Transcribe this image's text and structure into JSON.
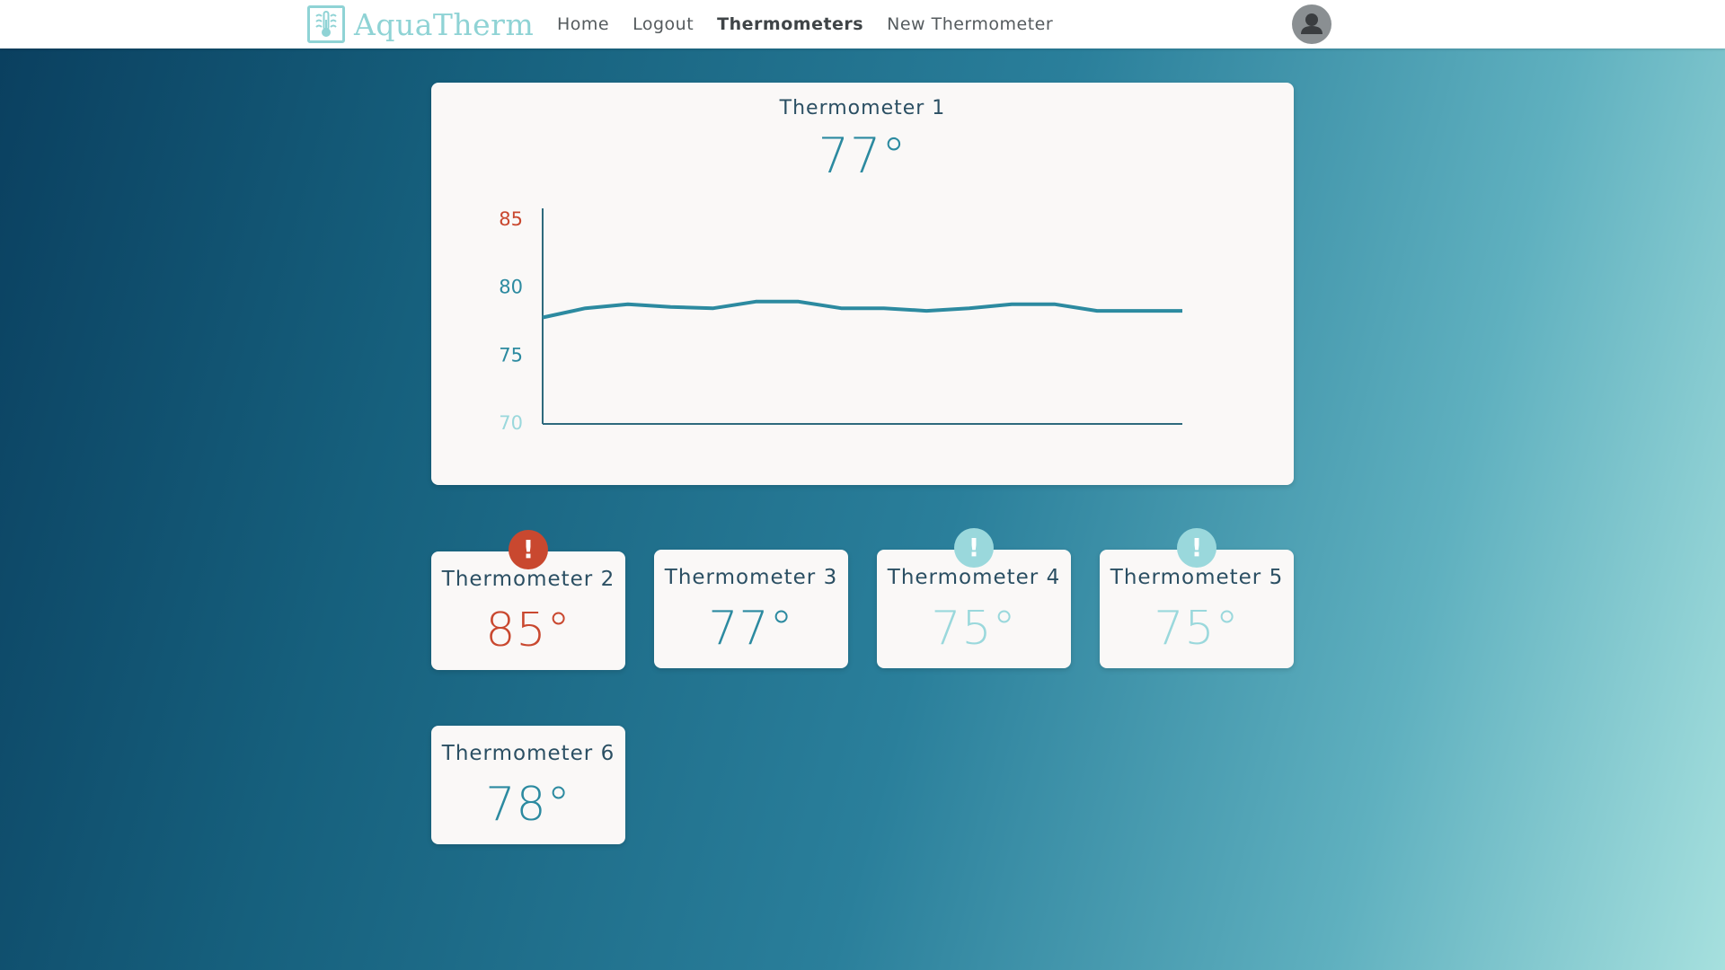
{
  "app": {
    "name": "AquaTherm"
  },
  "nav": {
    "home": "Home",
    "logout": "Logout",
    "thermometers": "Thermometers",
    "new_thermometer": "New Thermometer"
  },
  "colors": {
    "normal": "#2c8aa0",
    "high": "#c9482f",
    "low": "#9ad8dc",
    "alert_high": "#c9482f",
    "alert_low": "#9ad8dc"
  },
  "main": {
    "title": "Thermometer 1",
    "temp": "77°"
  },
  "chart_data": {
    "type": "line",
    "title": "",
    "xlabel": "",
    "ylabel": "",
    "ylim": [
      70,
      86
    ],
    "y_ticks": [
      {
        "value": 85,
        "label": "85",
        "color": "#c9482f"
      },
      {
        "value": 80,
        "label": "80",
        "color": "#2c8aa0"
      },
      {
        "value": 75,
        "label": "75",
        "color": "#2c8aa0"
      },
      {
        "value": 70,
        "label": "70",
        "color": "#9ad8dc"
      }
    ],
    "grid": false,
    "series": [
      {
        "values": [
          77.9,
          78.6,
          78.9,
          78.7,
          78.6,
          79.1,
          79.1,
          78.6,
          78.6,
          78.4,
          78.6,
          78.9,
          78.9,
          78.4,
          78.4,
          78.4
        ]
      }
    ]
  },
  "thermometers": [
    {
      "title": "Thermometer 2",
      "temp": "85°",
      "status": "high",
      "alert": "!"
    },
    {
      "title": "Thermometer 3",
      "temp": "77°",
      "status": "normal",
      "alert": ""
    },
    {
      "title": "Thermometer 4",
      "temp": "75°",
      "status": "low",
      "alert": "!"
    },
    {
      "title": "Thermometer 5",
      "temp": "75°",
      "status": "low",
      "alert": "!"
    },
    {
      "title": "Thermometer 6",
      "temp": "78°",
      "status": "normal",
      "alert": ""
    }
  ]
}
